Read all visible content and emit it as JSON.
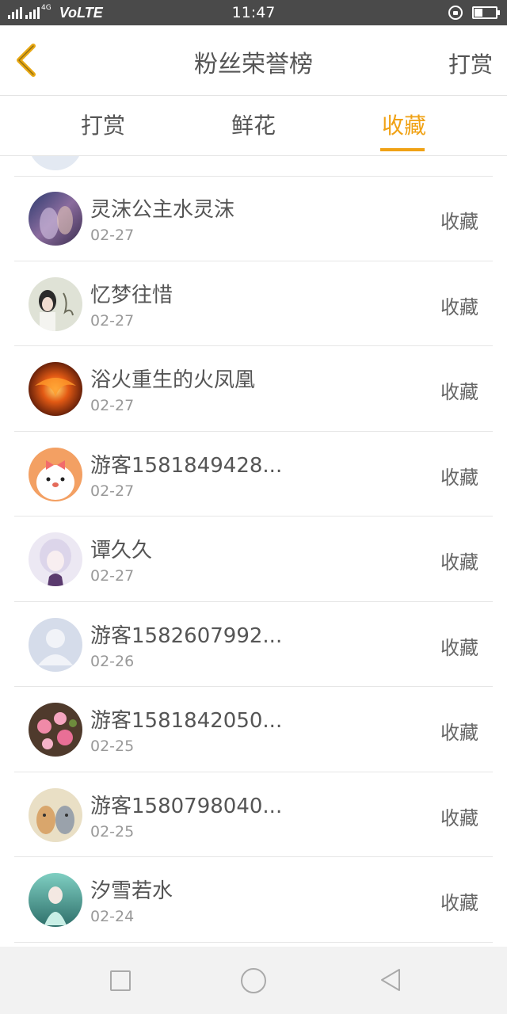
{
  "status_bar": {
    "network": "4G",
    "volte": "VoLTE",
    "time": "11:47"
  },
  "header": {
    "title": "粉丝荣誉榜",
    "action": "打赏",
    "back_icon": "chevron-left-icon",
    "back_color": "#e8a813"
  },
  "tabs": [
    {
      "label": "打赏",
      "active": false
    },
    {
      "label": "鲜花",
      "active": false
    },
    {
      "label": "收藏",
      "active": true
    }
  ],
  "accent_color": "#f0a215",
  "list": [
    {
      "name": "灵沫公主水灵沫",
      "date": "02-27",
      "action": "收藏"
    },
    {
      "name": "忆梦往惜",
      "date": "02-27",
      "action": "收藏"
    },
    {
      "name": "浴火重生的火凤凰",
      "date": "02-27",
      "action": "收藏"
    },
    {
      "name": "游客1581849428...",
      "date": "02-27",
      "action": "收藏"
    },
    {
      "name": "谭久久",
      "date": "02-27",
      "action": "收藏"
    },
    {
      "name": "游客1582607992...",
      "date": "02-26",
      "action": "收藏"
    },
    {
      "name": "游客1581842050...",
      "date": "02-25",
      "action": "收藏"
    },
    {
      "name": "游客1580798040...",
      "date": "02-25",
      "action": "收藏"
    },
    {
      "name": "汐雪若水",
      "date": "02-24",
      "action": "收藏"
    }
  ]
}
